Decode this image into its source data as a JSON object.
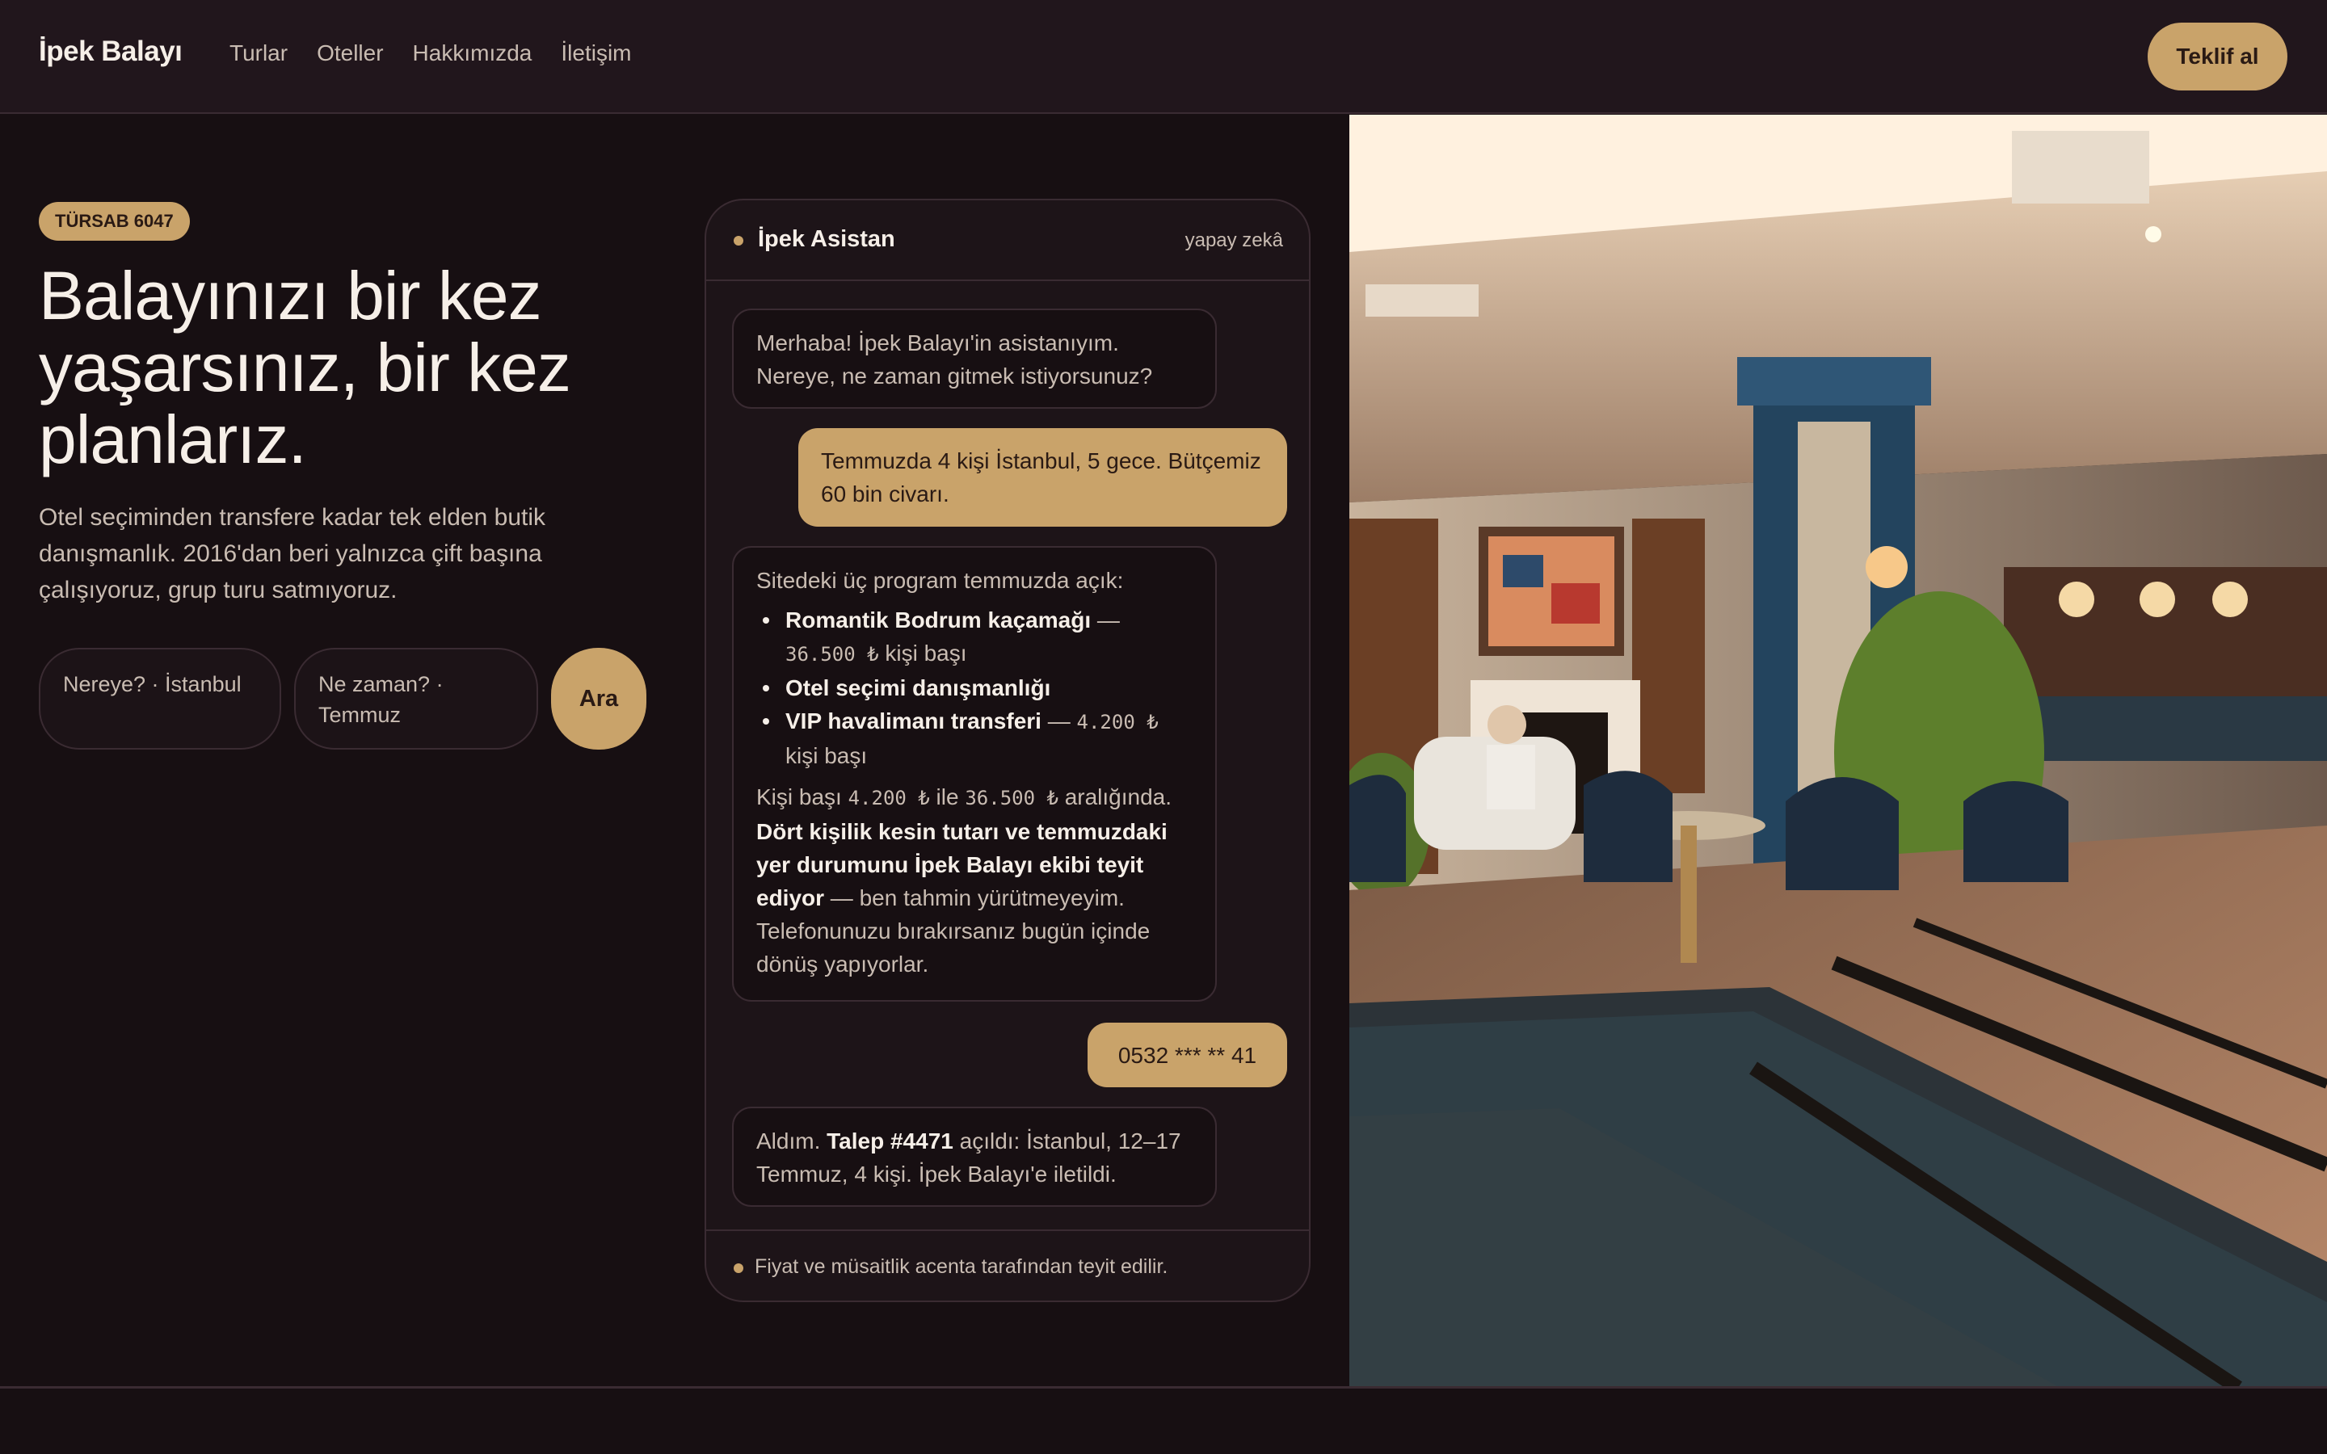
{
  "header": {
    "brand": "İpek Balayı",
    "nav": [
      "Turlar",
      "Oteller",
      "Hakkımızda",
      "İletişim"
    ],
    "cta": "Teklif al"
  },
  "hero": {
    "badge": "TÜRSAB 6047",
    "title": "Balayınızı bir kez yaşarsınız, bir kez planlarız.",
    "subtitle": "Otel seçiminden transfere kadar tek elden butik danışmanlık. 2016'dan beri yalnızca çift başına çalışıyoruz, grup turu satmıyoruz."
  },
  "search": {
    "where": "Nereye? · İstanbul",
    "when": "Ne zaman? · Temmuz",
    "button": "Ara"
  },
  "chat": {
    "name": "İpek Asistan",
    "tag": "yapay zekâ",
    "msg1": "Merhaba! İpek Balayı'in asistanıyım. Nereye, ne zaman gitmek istiyorsunuz?",
    "msg2": "Temmuzda 4 kişi İstanbul, 5 gece. Bütçemiz 60 bin civarı.",
    "msg3": {
      "intro": "Sitedeki üç program temmuzda açık:",
      "items": [
        {
          "name": "Romantik Bodrum kaçamağı",
          "sep": " — ",
          "price": "36.500 ₺",
          "unit": " kişi başı"
        },
        {
          "name": "Otel seçimi danışmanlığı",
          "sep": "",
          "price": "",
          "unit": ""
        },
        {
          "name": "VIP havalimanı transferi",
          "sep": " — ",
          "price": "4.200 ₺",
          "unit": " kişi başı"
        }
      ],
      "range_a": "Kişi başı ",
      "range_low": "4.200 ₺",
      "range_b": " ile ",
      "range_high": "36.500 ₺",
      "range_c": " aralığında.",
      "bold": "Dört kişilik kesin tutarı ve temmuzdaki yer durumunu İpek Balayı ekibi teyit ediyor",
      "rest": " — ben tahmin yürütmeyeyim. Telefonunuzu bırakırsanız bugün içinde dönüş yapıyorlar."
    },
    "msg4": "0532 *** ** 41",
    "msg5": {
      "a": "Aldım. ",
      "bold": "Talep #4471",
      "b": " açıldı: İstanbul, 12–17 Temmuz, 4 kişi. İpek Balayı'e iletildi."
    },
    "footer": "Fiyat ve müsaitlik acenta tarafından teyit edilir."
  },
  "colors": {
    "background": "#170f12",
    "header": "#21161c",
    "accent": "#c9a36a",
    "text": "#f6efe8",
    "muted": "#c9bcb2"
  },
  "icons": [
    "status-dot-icon"
  ]
}
